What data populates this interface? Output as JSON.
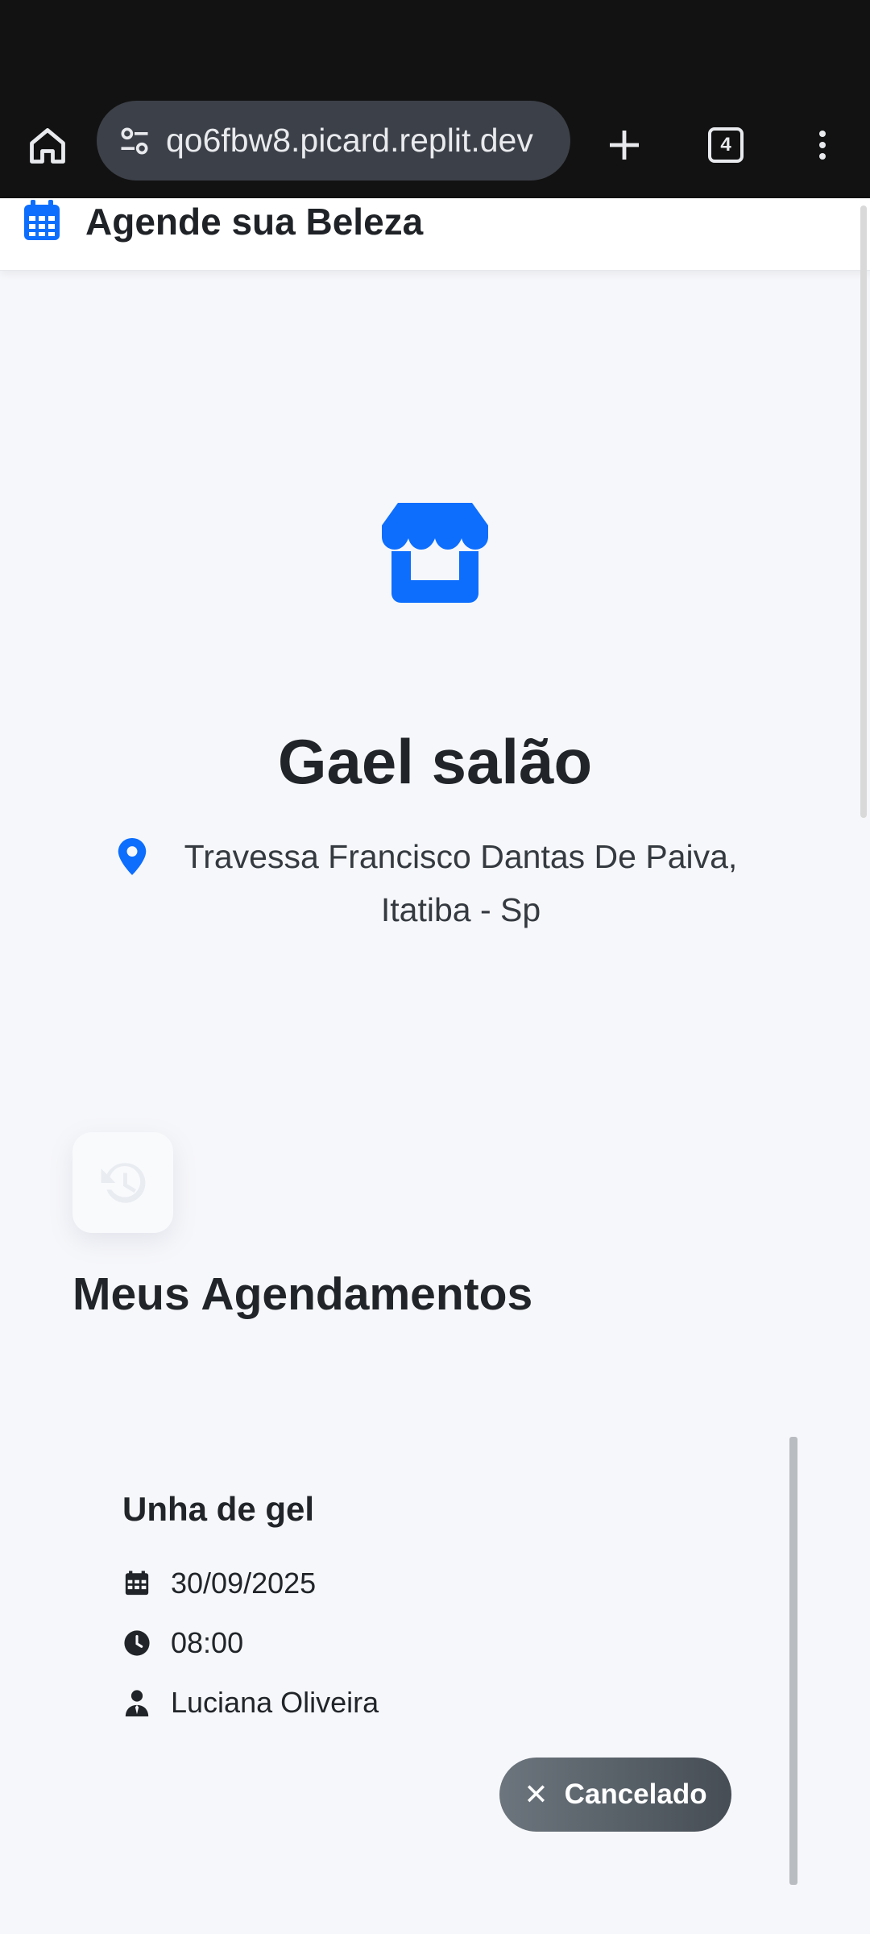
{
  "browser": {
    "url": "qo6fbw8.picard.replit.dev",
    "tab_count": "4"
  },
  "header": {
    "title": "Agende sua Beleza"
  },
  "salon": {
    "name": "Gael salão",
    "address": "Travessa Francisco Dantas De Paiva, Itatiba - Sp"
  },
  "appointments": {
    "section_title": "Meus Agendamentos",
    "items": [
      {
        "service": "Unha de gel",
        "date": "30/09/2025",
        "time": "08:00",
        "professional": "Luciana Oliveira",
        "status": "Cancelado"
      }
    ]
  },
  "icons": {
    "home": "home-icon",
    "site_info": "tune-icon",
    "new_tab": "plus-icon",
    "menu": "more-vert-icon",
    "brand": "calendar-icon",
    "store": "store-icon",
    "pin": "location-pin-icon",
    "history": "history-icon",
    "date": "calendar-icon",
    "time": "clock-icon",
    "professional": "person-tie-icon",
    "status": "close-icon"
  },
  "colors": {
    "primary": "#0d6efd",
    "badge": "#6c757d",
    "background": "#f6f7fa"
  }
}
